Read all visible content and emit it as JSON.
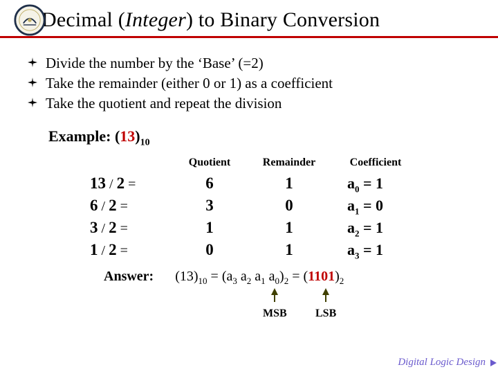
{
  "title": {
    "prefix": "Decimal (",
    "ital": "Integer",
    "suffix": ") to Binary Conversion"
  },
  "bullets": [
    "Divide the number by the ‘Base’ (=2)",
    "Take the remainder (either 0 or 1) as a coefficient",
    "Take the quotient and repeat the division"
  ],
  "example": {
    "label": "Example: (",
    "value": "13",
    "close": ")",
    "base": "10"
  },
  "columns": {
    "quotient": "Quotient",
    "remainder": "Remainder",
    "coefficient": "Coefficient"
  },
  "rows": [
    {
      "dividend": "13",
      "divisor": "2",
      "quotient": "6",
      "remainder": "1",
      "coef_idx": "0",
      "coef_val": "1"
    },
    {
      "dividend": "6",
      "divisor": "2",
      "quotient": "3",
      "remainder": "0",
      "coef_idx": "1",
      "coef_val": "0"
    },
    {
      "dividend": "3",
      "divisor": "2",
      "quotient": "1",
      "remainder": "1",
      "coef_idx": "2",
      "coef_val": "1"
    },
    {
      "dividend": "1",
      "divisor": "2",
      "quotient": "0",
      "remainder": "1",
      "coef_idx": "3",
      "coef_val": "1"
    }
  ],
  "answer": {
    "label": "Answer:",
    "lhs_open": "(13)",
    "lhs_base": "10",
    "eq1": " = (a",
    "a3": "3",
    "sp": " a",
    "a2": "2",
    "a1": "1",
    "a0": "0",
    "close2": ")",
    "rhs_base": "2",
    "eq2": " = (",
    "bin": "1101",
    "close3": ")",
    "rhs_base2": "2"
  },
  "labels": {
    "msb": "MSB",
    "lsb": "LSB"
  },
  "footer": "Digital Logic Design"
}
